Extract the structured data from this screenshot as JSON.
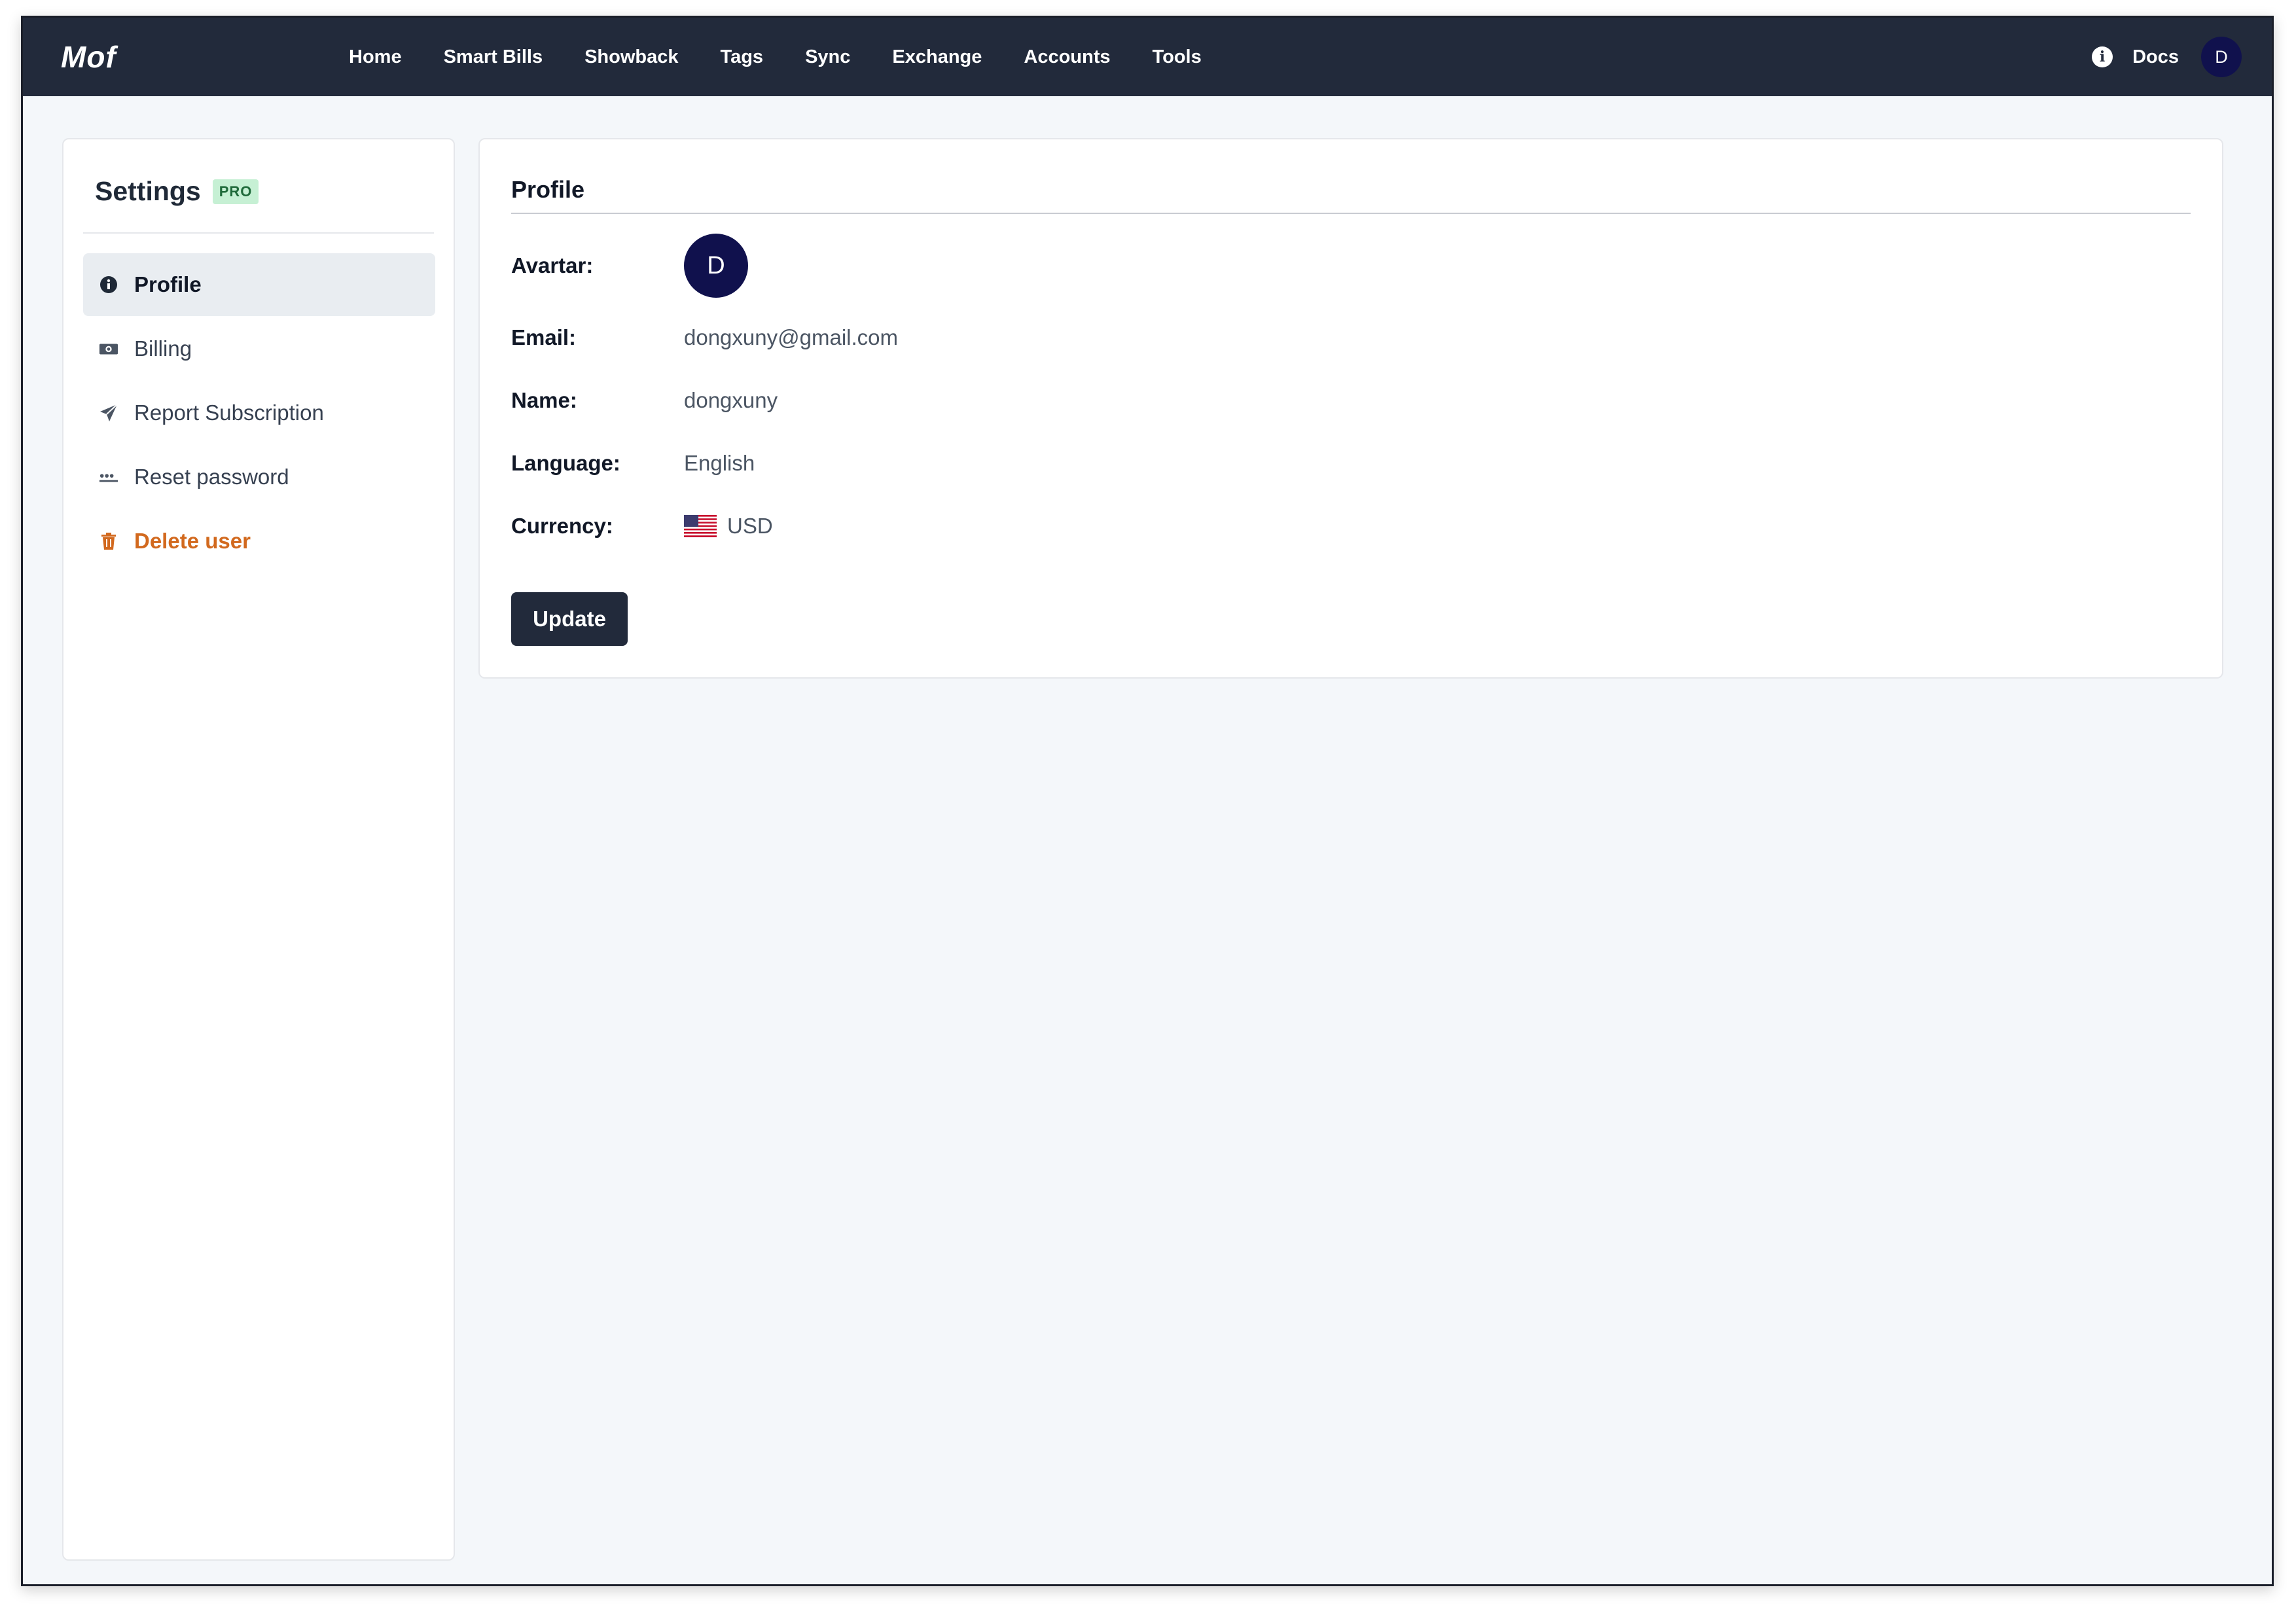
{
  "app": {
    "logo": "Mof"
  },
  "nav": {
    "items": [
      {
        "label": "Home"
      },
      {
        "label": "Smart Bills"
      },
      {
        "label": "Showback"
      },
      {
        "label": "Tags"
      },
      {
        "label": "Sync"
      },
      {
        "label": "Exchange"
      },
      {
        "label": "Accounts"
      },
      {
        "label": "Tools"
      }
    ],
    "docs_label": "Docs",
    "avatar_initial": "D"
  },
  "sidebar": {
    "title": "Settings",
    "badge": "PRO",
    "items": [
      {
        "label": "Profile",
        "icon": "info-icon",
        "active": true
      },
      {
        "label": "Billing",
        "icon": "money-icon"
      },
      {
        "label": "Report Subscription",
        "icon": "send-icon"
      },
      {
        "label": "Reset password",
        "icon": "password-icon"
      },
      {
        "label": "Delete user",
        "icon": "trash-icon",
        "danger": true
      }
    ]
  },
  "profile": {
    "title": "Profile",
    "avatar_label": "Avartar:",
    "avatar_initial": "D",
    "email_label": "Email:",
    "email_value": "dongxuny@gmail.com",
    "name_label": "Name:",
    "name_value": "dongxuny",
    "language_label": "Language:",
    "language_value": "English",
    "currency_label": "Currency:",
    "currency_value": "USD",
    "currency_flag_icon": "us-flag-icon",
    "update_label": "Update"
  },
  "colors": {
    "nav_bg": "#222a3b",
    "avatar_bg": "#10114d",
    "danger": "#d2691e",
    "badge_bg": "#c6f0d4"
  }
}
